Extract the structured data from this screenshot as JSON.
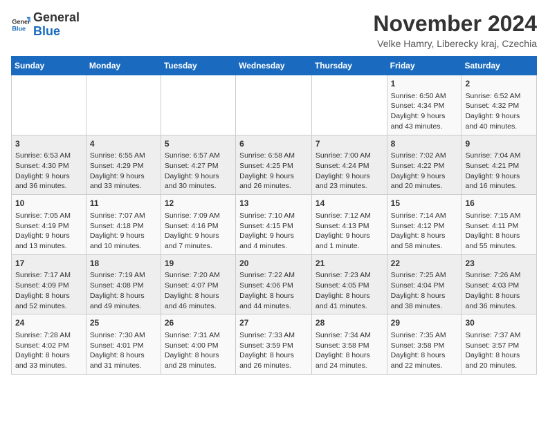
{
  "logo": {
    "text_general": "General",
    "text_blue": "Blue"
  },
  "title": "November 2024",
  "location": "Velke Hamry, Liberecky kraj, Czechia",
  "days_of_week": [
    "Sunday",
    "Monday",
    "Tuesday",
    "Wednesday",
    "Thursday",
    "Friday",
    "Saturday"
  ],
  "weeks": [
    [
      {
        "day": "",
        "info": ""
      },
      {
        "day": "",
        "info": ""
      },
      {
        "day": "",
        "info": ""
      },
      {
        "day": "",
        "info": ""
      },
      {
        "day": "",
        "info": ""
      },
      {
        "day": "1",
        "info": "Sunrise: 6:50 AM\nSunset: 4:34 PM\nDaylight: 9 hours and 43 minutes."
      },
      {
        "day": "2",
        "info": "Sunrise: 6:52 AM\nSunset: 4:32 PM\nDaylight: 9 hours and 40 minutes."
      }
    ],
    [
      {
        "day": "3",
        "info": "Sunrise: 6:53 AM\nSunset: 4:30 PM\nDaylight: 9 hours and 36 minutes."
      },
      {
        "day": "4",
        "info": "Sunrise: 6:55 AM\nSunset: 4:29 PM\nDaylight: 9 hours and 33 minutes."
      },
      {
        "day": "5",
        "info": "Sunrise: 6:57 AM\nSunset: 4:27 PM\nDaylight: 9 hours and 30 minutes."
      },
      {
        "day": "6",
        "info": "Sunrise: 6:58 AM\nSunset: 4:25 PM\nDaylight: 9 hours and 26 minutes."
      },
      {
        "day": "7",
        "info": "Sunrise: 7:00 AM\nSunset: 4:24 PM\nDaylight: 9 hours and 23 minutes."
      },
      {
        "day": "8",
        "info": "Sunrise: 7:02 AM\nSunset: 4:22 PM\nDaylight: 9 hours and 20 minutes."
      },
      {
        "day": "9",
        "info": "Sunrise: 7:04 AM\nSunset: 4:21 PM\nDaylight: 9 hours and 16 minutes."
      }
    ],
    [
      {
        "day": "10",
        "info": "Sunrise: 7:05 AM\nSunset: 4:19 PM\nDaylight: 9 hours and 13 minutes."
      },
      {
        "day": "11",
        "info": "Sunrise: 7:07 AM\nSunset: 4:18 PM\nDaylight: 9 hours and 10 minutes."
      },
      {
        "day": "12",
        "info": "Sunrise: 7:09 AM\nSunset: 4:16 PM\nDaylight: 9 hours and 7 minutes."
      },
      {
        "day": "13",
        "info": "Sunrise: 7:10 AM\nSunset: 4:15 PM\nDaylight: 9 hours and 4 minutes."
      },
      {
        "day": "14",
        "info": "Sunrise: 7:12 AM\nSunset: 4:13 PM\nDaylight: 9 hours and 1 minute."
      },
      {
        "day": "15",
        "info": "Sunrise: 7:14 AM\nSunset: 4:12 PM\nDaylight: 8 hours and 58 minutes."
      },
      {
        "day": "16",
        "info": "Sunrise: 7:15 AM\nSunset: 4:11 PM\nDaylight: 8 hours and 55 minutes."
      }
    ],
    [
      {
        "day": "17",
        "info": "Sunrise: 7:17 AM\nSunset: 4:09 PM\nDaylight: 8 hours and 52 minutes."
      },
      {
        "day": "18",
        "info": "Sunrise: 7:19 AM\nSunset: 4:08 PM\nDaylight: 8 hours and 49 minutes."
      },
      {
        "day": "19",
        "info": "Sunrise: 7:20 AM\nSunset: 4:07 PM\nDaylight: 8 hours and 46 minutes."
      },
      {
        "day": "20",
        "info": "Sunrise: 7:22 AM\nSunset: 4:06 PM\nDaylight: 8 hours and 44 minutes."
      },
      {
        "day": "21",
        "info": "Sunrise: 7:23 AM\nSunset: 4:05 PM\nDaylight: 8 hours and 41 minutes."
      },
      {
        "day": "22",
        "info": "Sunrise: 7:25 AM\nSunset: 4:04 PM\nDaylight: 8 hours and 38 minutes."
      },
      {
        "day": "23",
        "info": "Sunrise: 7:26 AM\nSunset: 4:03 PM\nDaylight: 8 hours and 36 minutes."
      }
    ],
    [
      {
        "day": "24",
        "info": "Sunrise: 7:28 AM\nSunset: 4:02 PM\nDaylight: 8 hours and 33 minutes."
      },
      {
        "day": "25",
        "info": "Sunrise: 7:30 AM\nSunset: 4:01 PM\nDaylight: 8 hours and 31 minutes."
      },
      {
        "day": "26",
        "info": "Sunrise: 7:31 AM\nSunset: 4:00 PM\nDaylight: 8 hours and 28 minutes."
      },
      {
        "day": "27",
        "info": "Sunrise: 7:33 AM\nSunset: 3:59 PM\nDaylight: 8 hours and 26 minutes."
      },
      {
        "day": "28",
        "info": "Sunrise: 7:34 AM\nSunset: 3:58 PM\nDaylight: 8 hours and 24 minutes."
      },
      {
        "day": "29",
        "info": "Sunrise: 7:35 AM\nSunset: 3:58 PM\nDaylight: 8 hours and 22 minutes."
      },
      {
        "day": "30",
        "info": "Sunrise: 7:37 AM\nSunset: 3:57 PM\nDaylight: 8 hours and 20 minutes."
      }
    ]
  ]
}
